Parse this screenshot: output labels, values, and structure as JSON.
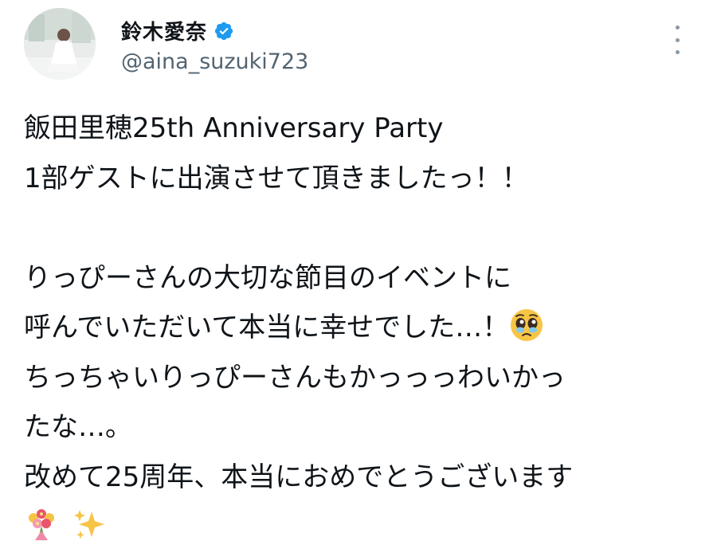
{
  "author": {
    "display_name": "鈴木愛奈",
    "handle": "@aina_suzuki723",
    "verified_icon": "verified-badge-icon",
    "avatar": "profile-photo"
  },
  "menu_icon": "more-options-icon",
  "colors": {
    "text": "#0f1419",
    "handle": "#536471",
    "verified": "#1d9bf0",
    "menu_dots": "#8b98a5"
  },
  "post": {
    "lines": [
      "飯田里穂25th Anniversary Party",
      "1部ゲストに出演させて頂きましたっ！！",
      "",
      "りっぴーさんの大切な節目のイベントに",
      "呼んでいただいて本当に幸せでした…！",
      "ちっちゃいりっぴーさんもかっっっわいかっ",
      "たな…。",
      "改めて25周年、本当におめでとうございます",
      ""
    ],
    "emojis": {
      "line5": "pleading-face-emoji",
      "line9": [
        "bouquet-emoji",
        "sparkles-emoji"
      ]
    }
  }
}
